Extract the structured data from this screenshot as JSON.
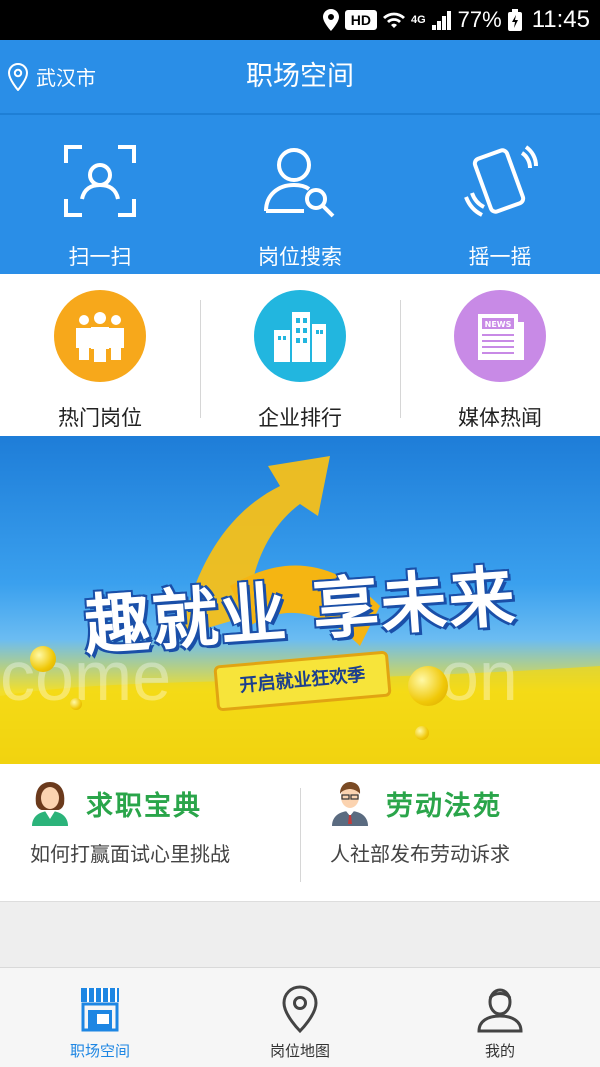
{
  "status_bar": {
    "hd": "HD",
    "network": "4G",
    "battery": "77%",
    "time": "11:45"
  },
  "header": {
    "city": "武汉市",
    "title": "职场空间"
  },
  "quick_actions": [
    {
      "label": "扫一扫",
      "icon": "scan-icon"
    },
    {
      "label": "岗位搜索",
      "icon": "job-search-icon"
    },
    {
      "label": "摇一摇",
      "icon": "shake-phone-icon"
    }
  ],
  "categories": [
    {
      "label": "热门岗位",
      "icon": "people-group-icon",
      "color": "#f7a81b"
    },
    {
      "label": "企业排行",
      "icon": "buildings-icon",
      "color": "#22b6df"
    },
    {
      "label": "媒体热闻",
      "icon": "newspaper-icon",
      "color": "#c88ae6"
    }
  ],
  "banner": {
    "headline": "趣就业 享未来",
    "ribbon": "开启就业狂欢季",
    "watermark_left": "come",
    "watermark_right": "on"
  },
  "articles": [
    {
      "title": "求职宝典",
      "subtitle": "如何打赢面试心里挑战",
      "icon": "woman-avatar-icon"
    },
    {
      "title": "劳动法苑",
      "subtitle": "人社部发布劳动诉求",
      "icon": "man-avatar-icon"
    }
  ],
  "tabs": [
    {
      "label": "职场空间",
      "icon": "storefront-icon",
      "active": true
    },
    {
      "label": "岗位地图",
      "icon": "map-pin-icon",
      "active": false
    },
    {
      "label": "我的",
      "icon": "user-icon",
      "active": false
    }
  ],
  "colors": {
    "primary": "#2a8ee7",
    "green_title": "#2aa54a",
    "active_tab": "#1d86e3"
  }
}
